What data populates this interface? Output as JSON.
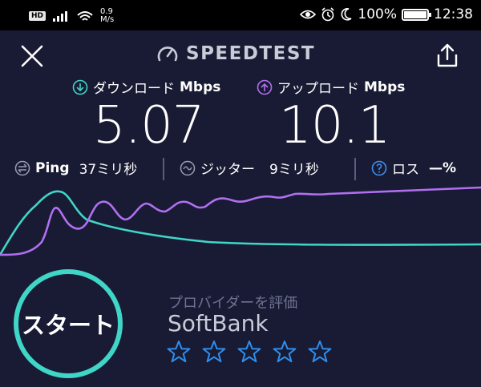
{
  "status_bar": {
    "hd_badge": "HD",
    "net_speed_value": "0.9",
    "net_speed_unit": "M/s",
    "battery_percent": "100%",
    "battery_level": 1.0,
    "time": "12:38"
  },
  "header": {
    "title": "SPEEDTEST"
  },
  "download": {
    "label": "ダウンロード",
    "unit": "Mbps",
    "value": "5.07",
    "color": "#3fd6c8"
  },
  "upload": {
    "label": "アップロード",
    "unit": "Mbps",
    "value": "10.1",
    "color": "#b06ff0"
  },
  "stats": {
    "ping_label": "Ping",
    "ping_value": "37ミリ秒",
    "jitter_label": "ジッター",
    "jitter_value": "9ミリ秒",
    "loss_label": "ロス",
    "loss_value": "—%"
  },
  "start_button": {
    "label": "スタート",
    "color": "#3fd6c8"
  },
  "provider": {
    "rate_label": "プロバイダーを評価",
    "name": "SoftBank",
    "rating_stars": 5,
    "star_color": "#2f8ff0"
  },
  "icons": [
    "hd-badge",
    "signal-icon",
    "wifi-icon",
    "eye-icon",
    "alarm-icon",
    "moon-icon",
    "battery-icon",
    "close-icon",
    "speedometer-icon",
    "share-icon",
    "download-icon",
    "upload-icon",
    "ping-icon",
    "jitter-icon",
    "help-icon",
    "star-icon"
  ]
}
